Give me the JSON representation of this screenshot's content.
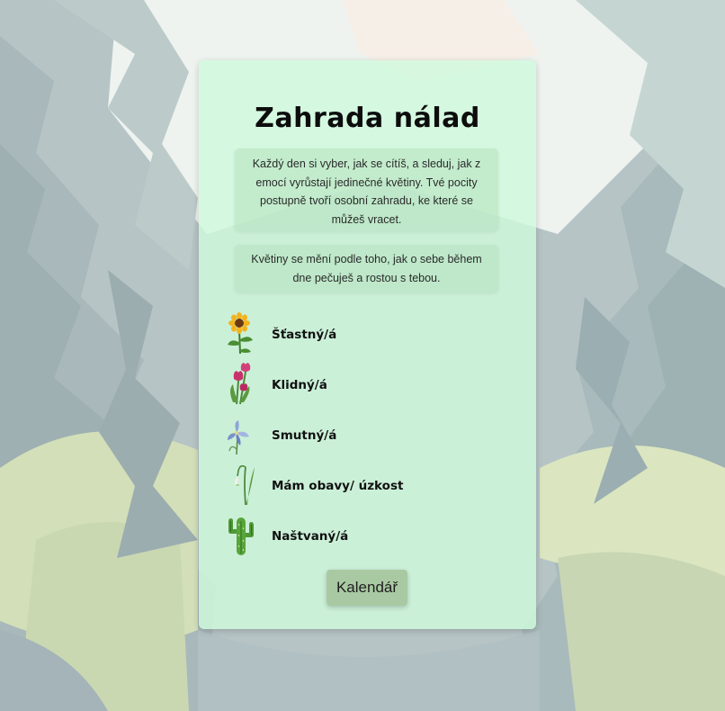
{
  "page": {
    "title": "Zahrada nálad",
    "intro_text": "Každý den si vyber, jak se cítíš, a sleduj, jak z emocí vyrůstají jedinečné květiny. Tvé pocity postupně tvoří osobní zahradu, ke které se můžeš vracet.",
    "change_text": "Květiny se mění podle toho, jak o sebe během dne pečuješ a rostou s tebou."
  },
  "moods": [
    {
      "label": "Šťastný/á",
      "icon": "sunflower-icon"
    },
    {
      "label": "Klidný/á",
      "icon": "tulip-icon"
    },
    {
      "label": "Smutný/á",
      "icon": "iris-icon"
    },
    {
      "label": "Mám obavy/ úzkost",
      "icon": "snowdrop-icon"
    },
    {
      "label": "Naštvaný/á",
      "icon": "cactus-icon"
    }
  ],
  "calendar_button": {
    "label": "Kalendář"
  },
  "colors": {
    "card": "#d0fadc",
    "info_box": "#b4e1be",
    "button": "#a9c9a3",
    "background_forest": "#b4c3c4"
  }
}
